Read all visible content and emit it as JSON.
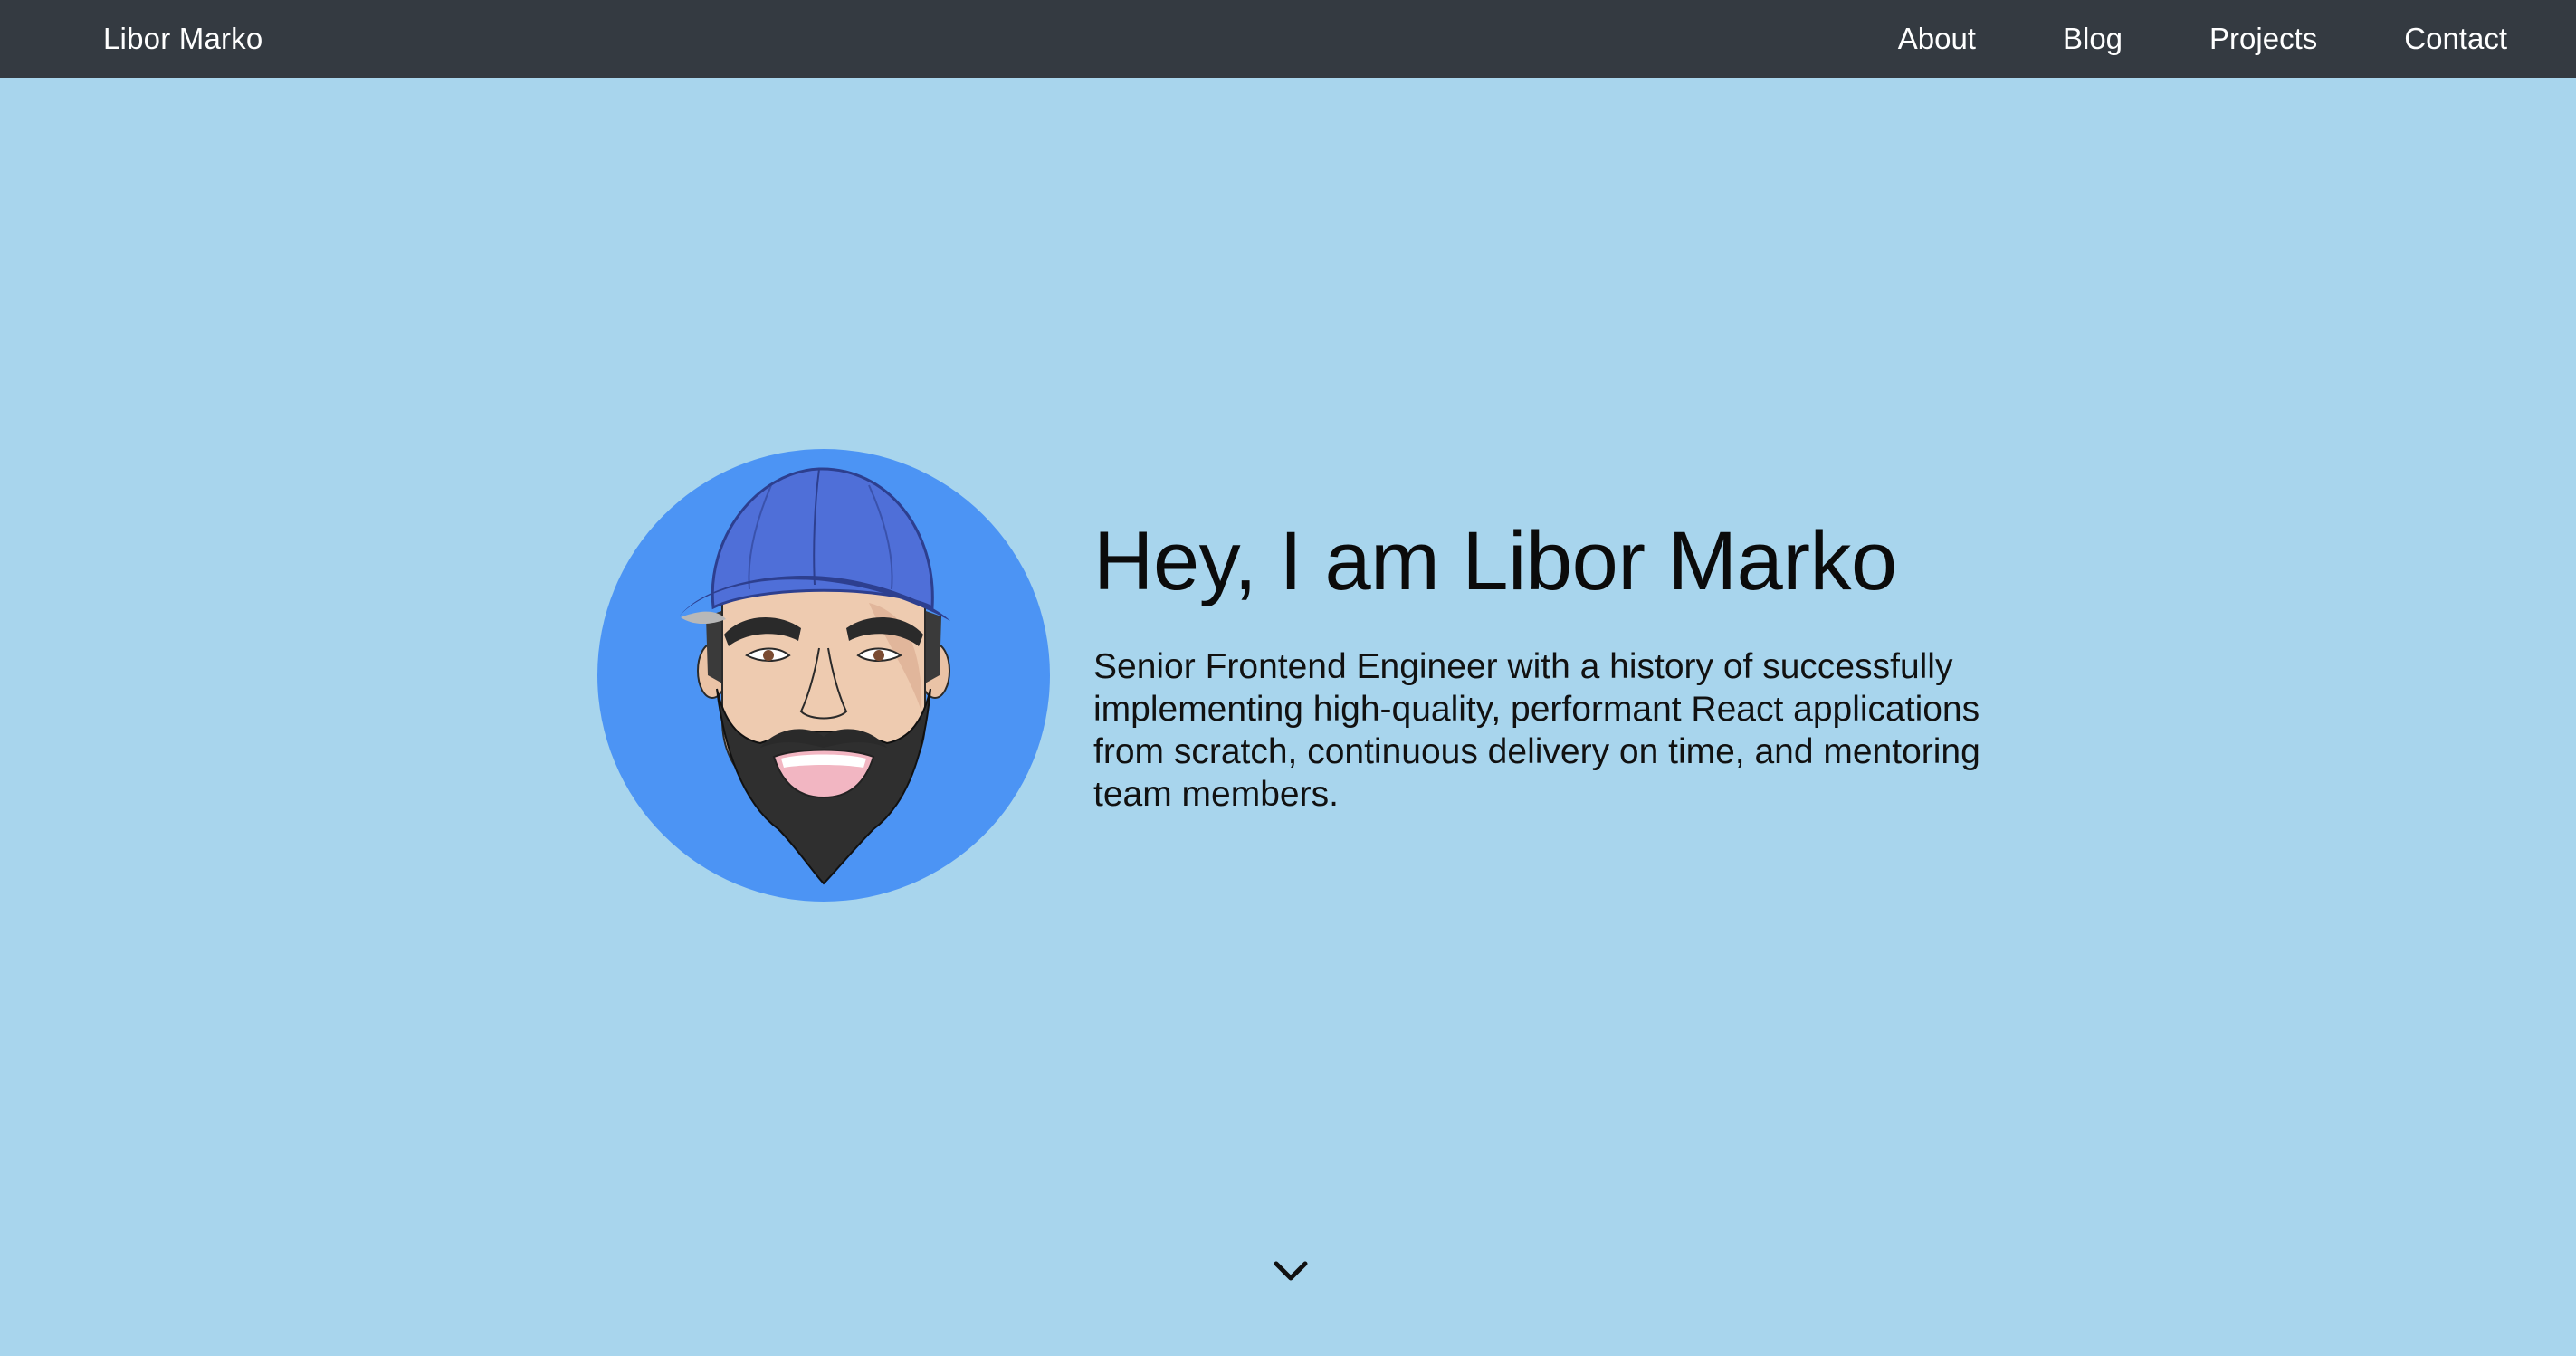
{
  "nav": {
    "brand": "Libor Marko",
    "links": [
      "About",
      "Blog",
      "Projects",
      "Contact"
    ]
  },
  "hero": {
    "title": "Hey, I am Libor Marko",
    "description": "Senior Frontend Engineer with a history of successfully implementing high-quality, performant React applications from scratch, continuous delivery on time, and mentoring team members."
  },
  "icons": {
    "scroll": "chevron-down-icon",
    "avatar": "cartoon-avatar-with-cap-and-beard"
  },
  "colors": {
    "navbar": "#343a41",
    "background": "#a8d5ed",
    "avatar_circle": "#4c94f4",
    "cap": "#4f6fd8"
  }
}
